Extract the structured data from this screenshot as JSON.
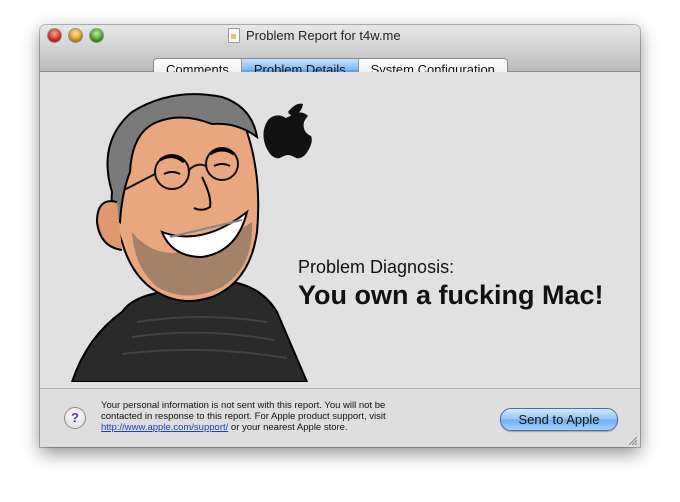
{
  "window": {
    "title": "Problem Report for t4w.me"
  },
  "tabs": [
    {
      "label": "Comments",
      "active": false
    },
    {
      "label": "Problem Details",
      "active": true
    },
    {
      "label": "System Configuration",
      "active": false
    }
  ],
  "diagnosis": {
    "label": "Problem Diagnosis:",
    "value": "You own a fucking Mac!"
  },
  "footer": {
    "help_label": "?",
    "note_line1": "Your personal information is not sent with this report. You will not be",
    "note_line2": "contacted in response to this report. For Apple product support, visit",
    "note_link": "http://www.apple.com/support/",
    "note_tail": " or your nearest Apple store.",
    "send_label": "Send to Apple"
  },
  "colors": {
    "active_tab": "#7eb7f5",
    "link": "#1a3ec7",
    "help_glyph": "#6a2fb0"
  },
  "icons": {
    "illustration": "cartoon-man-with-glasses",
    "logo": "apple-logo-icon",
    "document": "document-icon",
    "resize": "resize-grip-icon"
  }
}
